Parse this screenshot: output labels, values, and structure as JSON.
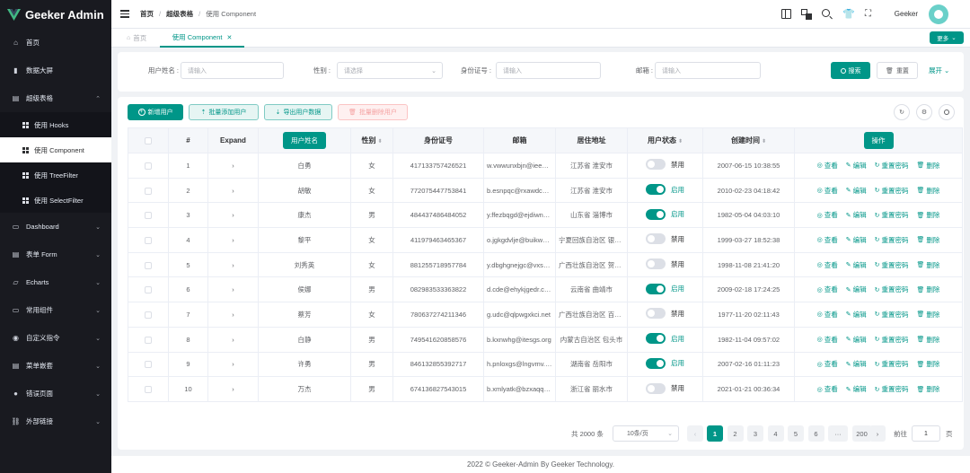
{
  "app": {
    "title": "Geeker Admin"
  },
  "sidebar": {
    "items": [
      {
        "label": "首页",
        "icon": "home-icon"
      },
      {
        "label": "数据大屏",
        "icon": "chart-icon"
      },
      {
        "label": "超级表格",
        "icon": "table-icon",
        "expanded": true
      },
      {
        "label": "Dashboard",
        "icon": "dashboard-icon"
      },
      {
        "label": "表单 Form",
        "icon": "form-icon"
      },
      {
        "label": "Echarts",
        "icon": "echarts-icon"
      },
      {
        "label": "常用组件",
        "icon": "component-icon"
      },
      {
        "label": "自定义指令",
        "icon": "directive-icon"
      },
      {
        "label": "菜单嵌套",
        "icon": "menu-icon"
      },
      {
        "label": "错误页面",
        "icon": "error-icon"
      },
      {
        "label": "外部链接",
        "icon": "link-icon"
      }
    ],
    "subitems": [
      {
        "label": "使用 Hooks"
      },
      {
        "label": "使用 Component",
        "active": true
      },
      {
        "label": "使用 TreeFilter"
      },
      {
        "label": "使用 SelectFilter"
      }
    ]
  },
  "header": {
    "breadcrumb": [
      "首页",
      "超级表格",
      "使用 Component"
    ],
    "username": "Geeker"
  },
  "tabs": {
    "items": [
      {
        "label": "首页"
      },
      {
        "label": "使用 Component",
        "active": true
      }
    ],
    "more_label": "更多"
  },
  "search": {
    "fields": [
      {
        "label": "用户姓名 :",
        "placeholder": "请输入"
      },
      {
        "label": "性别 :",
        "placeholder": "请选择"
      },
      {
        "label": "身份证号 :",
        "placeholder": "请输入"
      },
      {
        "label": "邮箱 :",
        "placeholder": "请输入"
      }
    ],
    "search_label": "搜索",
    "reset_label": "重置",
    "expand_label": "展开"
  },
  "toolbar": {
    "add_user": "新增用户",
    "batch_add": "批量添加用户",
    "export": "导出用户数据",
    "batch_delete": "批量删除用户"
  },
  "table": {
    "headers": [
      "#",
      "Expand",
      "用户姓名",
      "性别",
      "身份证号",
      "邮箱",
      "居住地址",
      "用户状态",
      "创建时间",
      "操作"
    ],
    "status_on": "启用",
    "status_off": "禁用",
    "ops": [
      "查看",
      "编辑",
      "重置密码",
      "删除"
    ],
    "rows": [
      {
        "idx": "1",
        "name": "白勇",
        "gender": "女",
        "id": "417133757426521",
        "email": "w.vwwunxbjn@ieeoabv.com",
        "addr": "江苏省 淮安市",
        "status": false,
        "time": "2007-06-15 10:38:55"
      },
      {
        "idx": "2",
        "name": "胡敏",
        "gender": "女",
        "id": "772075447753841",
        "email": "b.esnpqc@rxawdcq.net",
        "addr": "江苏省 淮安市",
        "status": true,
        "time": "2010-02-23 04:18:42"
      },
      {
        "idx": "3",
        "name": "康杰",
        "gender": "男",
        "id": "484437486484052",
        "email": "y.ffezbqgd@ejdiwnq.org",
        "addr": "山东省 淄博市",
        "status": true,
        "time": "1982-05-04 04:03:10"
      },
      {
        "idx": "4",
        "name": "黎平",
        "gender": "女",
        "id": "411979463465367",
        "email": "o.jgkgdvlje@buikwp.gov",
        "addr": "宁夏回族自治区 银川市",
        "status": false,
        "time": "1999-03-27 18:52:38"
      },
      {
        "idx": "5",
        "name": "刘秀英",
        "gender": "女",
        "id": "881255718957784",
        "email": "y.dbghgnejgc@vxsbyg.edu",
        "addr": "广西壮族自治区 贺州市",
        "status": false,
        "time": "1998-11-08 21:41:20"
      },
      {
        "idx": "6",
        "name": "侯娜",
        "gender": "男",
        "id": "082983533363822",
        "email": "d.cde@ehykjgedr.com",
        "addr": "云南省 曲靖市",
        "status": true,
        "time": "2009-02-18 17:24:25"
      },
      {
        "idx": "7",
        "name": "蔡芳",
        "gender": "女",
        "id": "780637274211346",
        "email": "g.udc@qlpwgxkci.net",
        "addr": "广西壮族自治区 百色市",
        "status": false,
        "time": "1977-11-20 02:11:43"
      },
      {
        "idx": "8",
        "name": "白静",
        "gender": "男",
        "id": "749541620858576",
        "email": "b.kxnwhg@itesgs.org",
        "addr": "内蒙古自治区 包头市",
        "status": true,
        "time": "1982-11-04 09:57:02"
      },
      {
        "idx": "9",
        "name": "许勇",
        "gender": "男",
        "id": "846132855392717",
        "email": "h.pnloxgs@lngvmv.gov",
        "addr": "湖南省 岳阳市",
        "status": true,
        "time": "2007-02-16 01:11:23"
      },
      {
        "idx": "10",
        "name": "万杰",
        "gender": "男",
        "id": "674136827543015",
        "email": "b.xmlyatk@bzxaqq.edu",
        "addr": "浙江省 丽水市",
        "status": false,
        "time": "2021-01-21 00:36:34"
      }
    ]
  },
  "pagination": {
    "total": "共 2000 条",
    "page_size": "10条/页",
    "pages": [
      "1",
      "2",
      "3",
      "4",
      "5",
      "6",
      "···",
      "200"
    ],
    "current": "1",
    "goto_label": "前往",
    "goto_value": "1",
    "page_unit": "页"
  },
  "footer": {
    "text": "2022 © Geeker-Admin By Geeker Technology."
  },
  "colors": {
    "primary": "#009688",
    "sidebar_bg": "#191a20"
  }
}
